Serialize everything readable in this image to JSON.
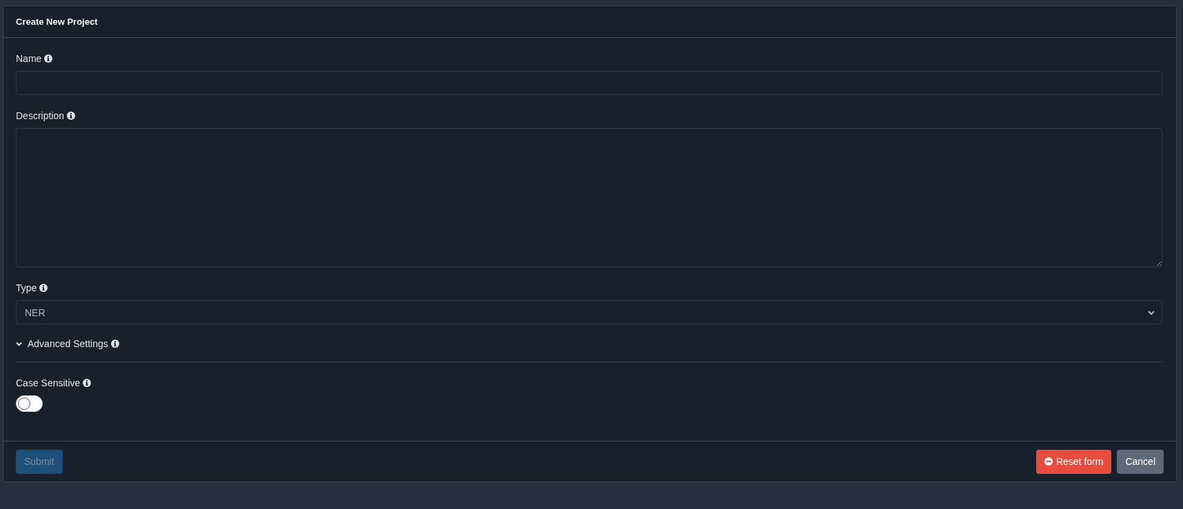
{
  "dialog": {
    "title": "Create New Project"
  },
  "fields": [
    {
      "kind": "text",
      "label": "Name"
    },
    {
      "kind": "textarea",
      "label": "Description"
    },
    {
      "kind": "select",
      "label": "Type",
      "value": "NER"
    }
  ],
  "advanced": {
    "label": "Advanced Settings",
    "expanded": true,
    "settings": [
      {
        "kind": "toggle",
        "label": "Case Sensitive",
        "on": false
      }
    ]
  },
  "buttons": [
    {
      "kind": "primary",
      "label": "Submit",
      "disabled": true
    },
    {
      "kind": "danger",
      "label": "Reset form",
      "disabled": false
    },
    {
      "kind": "secondary",
      "label": "Cancel",
      "disabled": false
    }
  ]
}
